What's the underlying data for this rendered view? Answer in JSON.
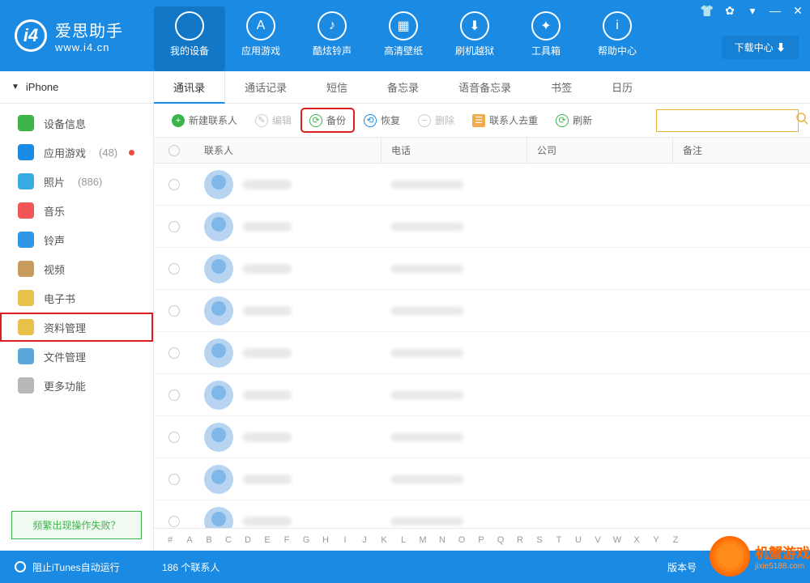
{
  "app": {
    "title": "爱思助手",
    "subtitle": "www.i4.cn"
  },
  "download_center": "下载中心",
  "main_nav": [
    {
      "label": "我的设备",
      "active": true
    },
    {
      "label": "应用游戏"
    },
    {
      "label": "酷炫铃声"
    },
    {
      "label": "高清壁纸"
    },
    {
      "label": "刷机越狱"
    },
    {
      "label": "工具箱"
    },
    {
      "label": "帮助中心"
    }
  ],
  "device_selector": "iPhone",
  "sidebar": [
    {
      "label": "设备信息",
      "color": "#3bb54a"
    },
    {
      "label": "应用游戏",
      "count": "(48)",
      "dot": true,
      "color": "#1b8ae2"
    },
    {
      "label": "照片",
      "count": "(886)",
      "color": "#3ba9e4"
    },
    {
      "label": "音乐",
      "color": "#f05656"
    },
    {
      "label": "铃声",
      "color": "#2e98e6"
    },
    {
      "label": "视频",
      "color": "#c79b5d"
    },
    {
      "label": "电子书",
      "color": "#e8c14a"
    },
    {
      "label": "资料管理",
      "selected": true,
      "color": "#e8c14a"
    },
    {
      "label": "文件管理",
      "color": "#5aa6d8"
    },
    {
      "label": "更多功能",
      "color": "#b8b8b8"
    }
  ],
  "sidebar_footer": "频繁出现操作失败？",
  "sub_tabs": [
    {
      "label": "通讯录",
      "active": true
    },
    {
      "label": "通话记录"
    },
    {
      "label": "短信"
    },
    {
      "label": "备忘录"
    },
    {
      "label": "语音备忘录"
    },
    {
      "label": "书签"
    },
    {
      "label": "日历"
    }
  ],
  "toolbar": {
    "new_contact": "新建联系人",
    "edit": "编辑",
    "backup": "备份",
    "restore": "恢复",
    "delete": "删除",
    "dedupe": "联系人去重",
    "refresh": "刷新"
  },
  "columns": {
    "contact": "联系人",
    "phone": "电话",
    "company": "公司",
    "remark": "备注"
  },
  "contact_rows": 9,
  "alpha": [
    "#",
    "A",
    "B",
    "C",
    "D",
    "E",
    "F",
    "G",
    "H",
    "I",
    "J",
    "K",
    "L",
    "M",
    "N",
    "O",
    "P",
    "Q",
    "R",
    "S",
    "T",
    "U",
    "V",
    "W",
    "X",
    "Y",
    "Z"
  ],
  "status": {
    "itunes": "阻止iTunes自动运行",
    "count": "186 个联系人",
    "version": "版本号"
  },
  "watermark": {
    "title": "机蟹游戏",
    "sub": "jixie5188.com"
  }
}
